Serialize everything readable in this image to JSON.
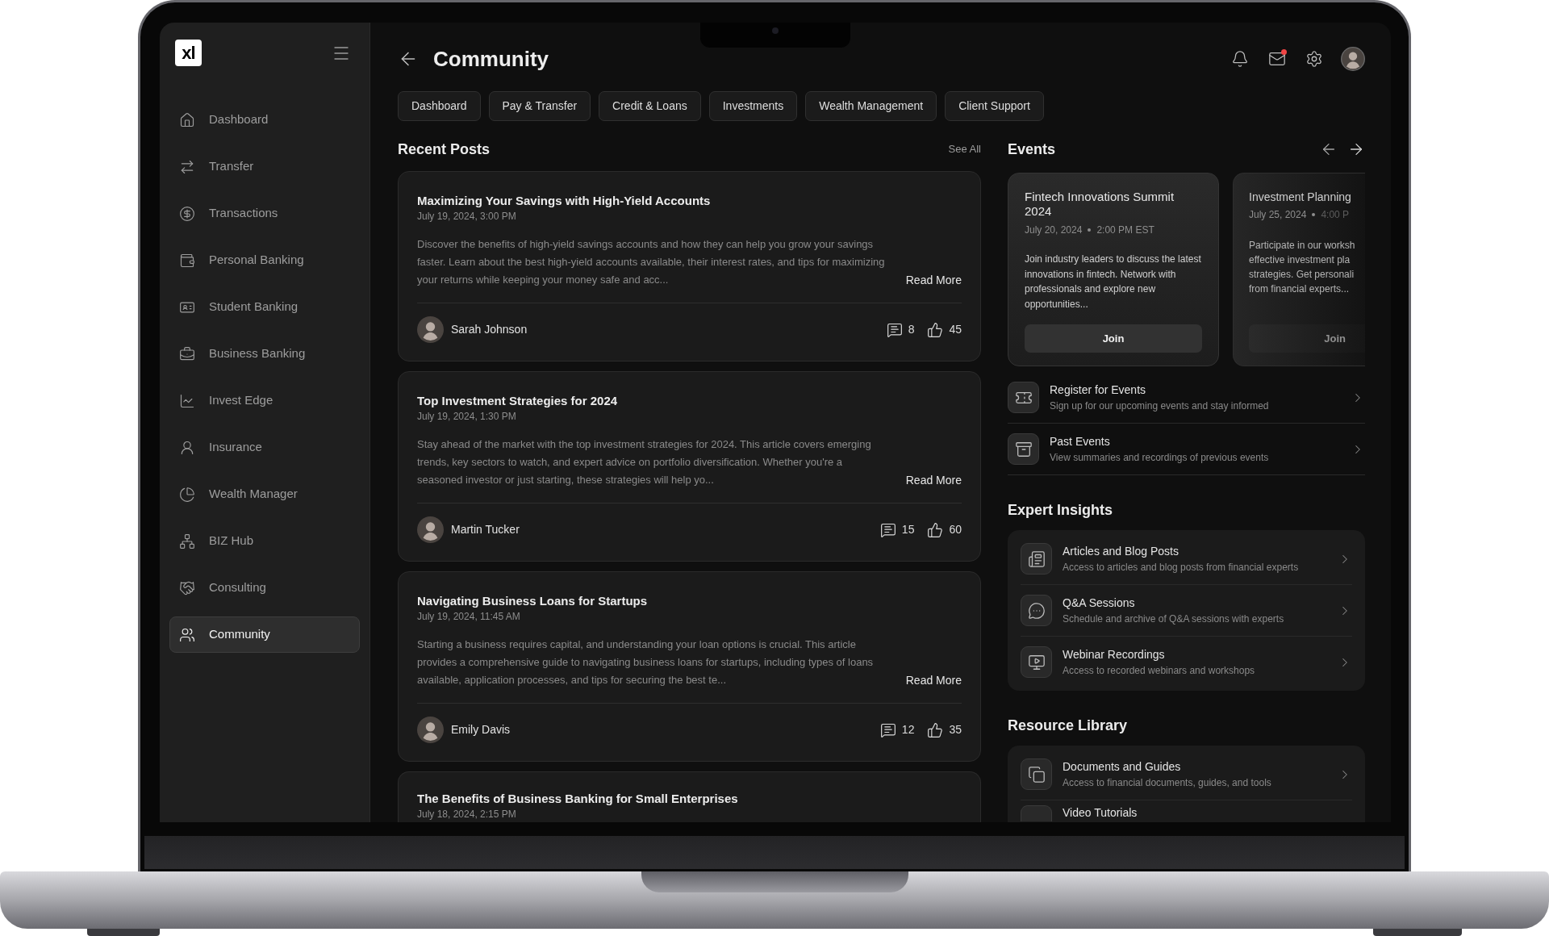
{
  "header": {
    "title": "Community",
    "mail_unread": true
  },
  "sidebar": {
    "logo": "xl",
    "items": [
      {
        "label": "Dashboard",
        "selected": false
      },
      {
        "label": "Transfer",
        "selected": false
      },
      {
        "label": "Transactions",
        "selected": false
      },
      {
        "label": "Personal Banking",
        "selected": false
      },
      {
        "label": "Student Banking",
        "selected": false
      },
      {
        "label": "Business Banking",
        "selected": false
      },
      {
        "label": "Invest Edge",
        "selected": false
      },
      {
        "label": "Insurance",
        "selected": false
      },
      {
        "label": "Wealth Manager",
        "selected": false
      },
      {
        "label": "BIZ Hub",
        "selected": false
      },
      {
        "label": "Consulting",
        "selected": false
      },
      {
        "label": "Community",
        "selected": true
      }
    ]
  },
  "quick_links": [
    "Dashboard",
    "Pay & Transfer",
    "Credit & Loans",
    "Investments",
    "Wealth Management",
    "Client Support"
  ],
  "recent_posts": {
    "heading": "Recent Posts",
    "see_all": "See All",
    "posts": [
      {
        "title": "Maximizing Your Savings with High-Yield Accounts",
        "date": "July 19, 2024, 3:00 PM",
        "excerpt": "Discover the benefits of high-yield savings accounts and how they can help you grow your savings faster. Learn about the best high-yield accounts available, their interest rates, and tips for maximizing your returns while keeping your money safe and acc...",
        "read_more": "Read More",
        "author": "Sarah Johnson",
        "comments": "8",
        "likes": "45"
      },
      {
        "title": "Top Investment Strategies for 2024",
        "date": "July 19, 2024, 1:30 PM",
        "excerpt": "Stay ahead of the market with the top investment strategies for 2024. This article covers emerging trends, key sectors to watch, and expert advice on portfolio diversification. Whether you're a seasoned investor or just starting, these strategies will help yo...",
        "read_more": "Read More",
        "author": "Martin Tucker",
        "comments": "15",
        "likes": "60"
      },
      {
        "title": "Navigating Business Loans for Startups",
        "date": "July 19, 2024, 11:45 AM",
        "excerpt": "Starting a business requires capital, and understanding your loan options is crucial. This article provides a comprehensive guide to navigating business loans for startups, including types of loans available, application processes, and tips for securing the best te...",
        "read_more": "Read More",
        "author": "Emily Davis",
        "comments": "12",
        "likes": "35"
      },
      {
        "title": "The Benefits of Business Banking for Small Enterprises",
        "date": "July 18, 2024, 2:15 PM"
      }
    ]
  },
  "events": {
    "heading": "Events",
    "cards": [
      {
        "title": "Fintech Innovations Summit 2024",
        "date": "July 20, 2024",
        "time": "2:00 PM EST",
        "description": "Join industry leaders to discuss the latest innovations in fintech. Network with professionals and explore new opportunities...",
        "button": "Join"
      },
      {
        "title": "Investment Planning",
        "date": "July 25, 2024",
        "time": "4:00 P",
        "description": "Participate in our worksh\neffective investment pla\nstrategies. Get personali\nfrom financial experts...",
        "button": "Join"
      }
    ],
    "links": [
      {
        "title": "Register for Events",
        "subtitle": "Sign up for our upcoming events and stay informed"
      },
      {
        "title": "Past Events",
        "subtitle": "View summaries and recordings of previous events"
      }
    ]
  },
  "expert_insights": {
    "heading": "Expert Insights",
    "items": [
      {
        "title": "Articles and Blog Posts",
        "subtitle": "Access to articles and blog posts from financial experts"
      },
      {
        "title": "Q&A Sessions",
        "subtitle": "Schedule and archive of Q&A sessions with experts"
      },
      {
        "title": "Webinar Recordings",
        "subtitle": "Access to recorded webinars and workshops"
      }
    ]
  },
  "resource_library": {
    "heading": "Resource Library",
    "items": [
      {
        "title": "Documents and Guides",
        "subtitle": "Access to financial documents, guides, and tools"
      },
      {
        "title": "Video Tutorials"
      }
    ]
  }
}
